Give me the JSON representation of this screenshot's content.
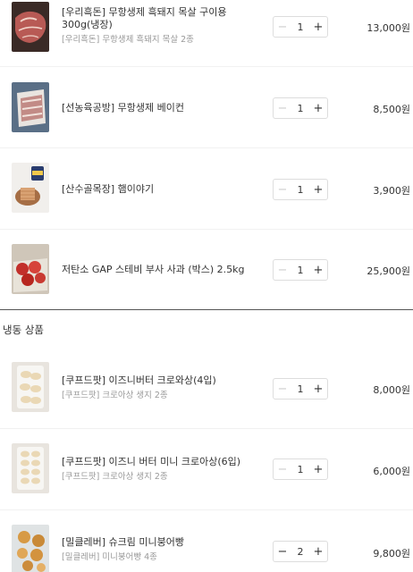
{
  "items": [
    {
      "name": "[우리흑돈] 무항생제 흑돼지 목살 구이용 300g(냉장)",
      "sub": "[우리흑돈] 무항생제 흑돼지 목살 2종",
      "qty": "1",
      "price": "13,000원"
    },
    {
      "name": "[선농육공방] 무항생제 베이컨",
      "sub": "",
      "qty": "1",
      "price": "8,500원"
    },
    {
      "name": "[산수골목장] 햄이야기",
      "sub": "",
      "qty": "1",
      "price": "3,900원"
    },
    {
      "name": "저탄소 GAP 스테비 부사 사과 (박스) 2.5kg",
      "sub": "",
      "qty": "1",
      "price": "25,900원"
    }
  ],
  "frozen_section": {
    "title": "냉동 상품"
  },
  "frozen_items": [
    {
      "name": "[쿠프드팟] 이즈니버터 크로와상(4입)",
      "sub": "[쿠프드팟] 크로아상 생지 2종",
      "qty": "1",
      "price": "8,000원"
    },
    {
      "name": "[쿠프드팟] 이즈니 버터 미니 크로아상(6입)",
      "sub": "[쿠프드팟] 크로아상 생지 2종",
      "qty": "1",
      "price": "6,000원"
    },
    {
      "name": "[밀클레버] 슈크림 미니붕어빵",
      "sub": "[밀클레버] 미니붕어빵 4종",
      "qty": "2",
      "price": "9,800원"
    }
  ],
  "stepper": {
    "minus": "−",
    "plus": "+"
  }
}
